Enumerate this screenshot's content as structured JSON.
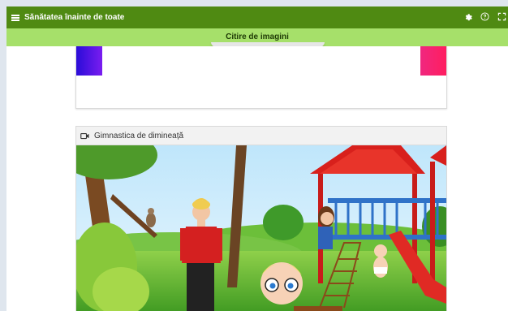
{
  "app": {
    "title": "Sănătatea înainte de toate"
  },
  "toolbar": {
    "icons": [
      "gear-icon",
      "help-icon",
      "fullscreen-icon"
    ]
  },
  "section": {
    "title": "Citire de imagini"
  },
  "video_card": {
    "title": "Gimnastica de dimineață",
    "icon": "video-camera-icon"
  },
  "colors": {
    "topbar": "#4f8a12",
    "subbar": "#a6e06a",
    "blue_bar": "#2a0cd8",
    "pink_bar": "#ff1e60"
  }
}
